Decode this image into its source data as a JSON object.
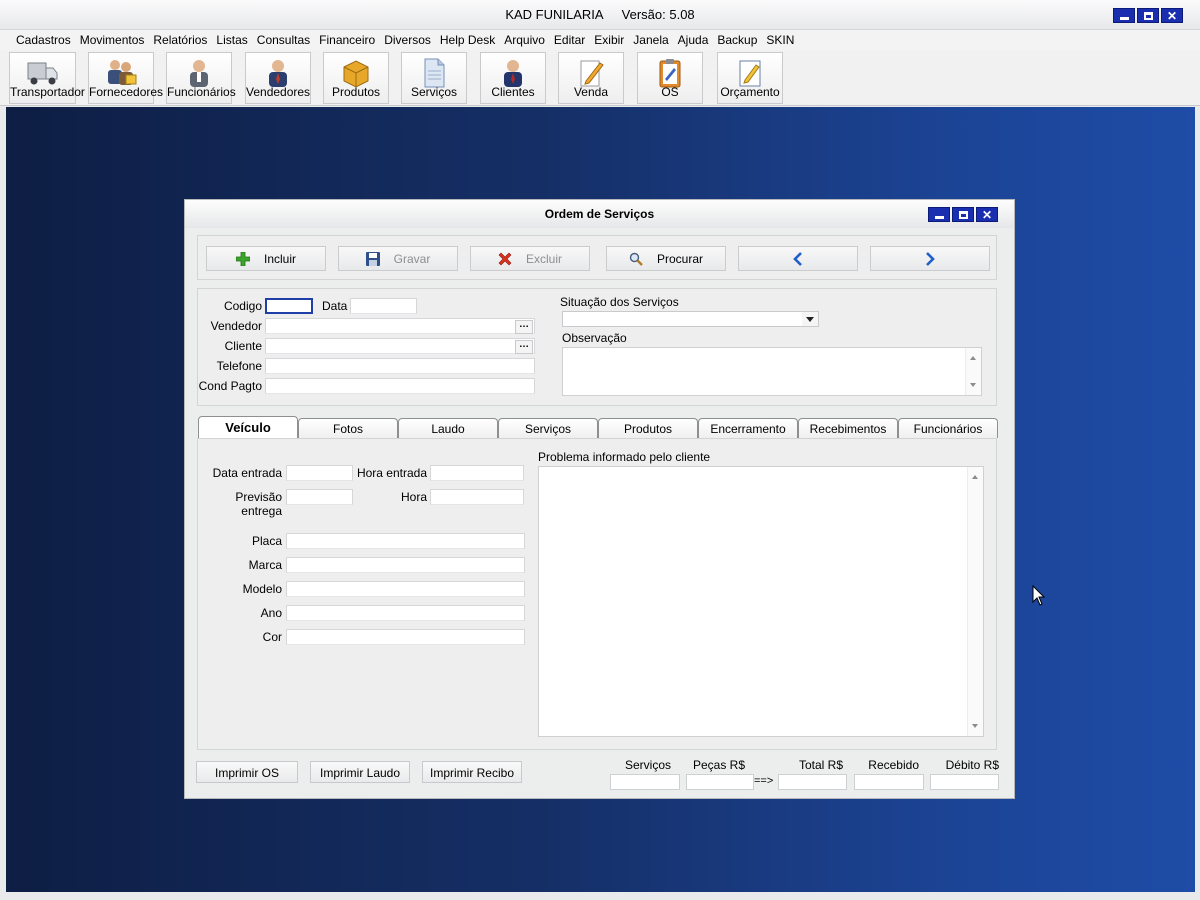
{
  "app": {
    "title": "KAD FUNILARIA",
    "version": "Versão: 5.08"
  },
  "menu": [
    "Cadastros",
    "Movimentos",
    "Relatórios",
    "Listas",
    "Consultas",
    "Financeiro",
    "Diversos",
    "Help Desk",
    "Arquivo",
    "Editar",
    "Exibir",
    "Janela",
    "Ajuda",
    "Backup",
    "SKIN"
  ],
  "toolbar": {
    "transportador": "Transportador",
    "fornecedores": "Fornecedores",
    "funcionarios": "Funcionários",
    "vendedores": "Vendedores",
    "produtos": "Produtos",
    "servicos": "Serviços",
    "clientes": "Clientes",
    "venda": "Venda",
    "os": "OS",
    "orcamento": "Orçamento"
  },
  "dialog": {
    "title": "Ordem de Serviços",
    "actions": {
      "incluir": "Incluir",
      "gravar": "Gravar",
      "excluir": "Excluir",
      "procurar": "Procurar"
    },
    "header": {
      "codigo_label": "Codigo",
      "codigo_value": "",
      "data_label": "Data",
      "data_value": "",
      "vendedor_label": "Vendedor",
      "vendedor_value": "",
      "cliente_label": "Cliente",
      "cliente_value": "",
      "telefone_label": "Telefone",
      "telefone_value": "",
      "cond_pagto_label": "Cond Pagto",
      "cond_pagto_value": "",
      "situacao_label": "Situação dos Serviços",
      "situacao_value": "",
      "observacao_label": "Observação",
      "observacao_value": ""
    },
    "tabs": [
      "Veículo",
      "Fotos",
      "Laudo",
      "Serviços",
      "Produtos",
      "Encerramento",
      "Recebimentos",
      "Funcionários"
    ],
    "active_tab": "Veículo",
    "veiculo": {
      "data_entrada_label": "Data entrada",
      "hora_entrada_label": "Hora entrada",
      "previsao_entrega_label": "Previsão entrega",
      "hora_label": "Hora",
      "placa_label": "Placa",
      "marca_label": "Marca",
      "modelo_label": "Modelo",
      "ano_label": "Ano",
      "cor_label": "Cor",
      "problema_label": "Problema informado pelo cliente"
    },
    "print_buttons": {
      "imprimir_os": "Imprimir OS",
      "imprimir_laudo": "Imprimir Laudo",
      "imprimir_recibo": "Imprimir Recibo"
    },
    "totals": {
      "servicos_label": "Serviços R$",
      "pecas_label": "Peças R$",
      "arrow": "==>",
      "total_label": "Total R$",
      "recebido_label": "Recebido R$",
      "debito_label": "Débito R$"
    }
  },
  "colors": {
    "desktop_dark": "#0e1e44",
    "desktop_light": "#1e4ca6",
    "window_button": "#1a2fb0",
    "incluir_icon": "#3aa52a",
    "excluir_icon": "#d9331f",
    "nav_arrow": "#1f5fc8"
  }
}
